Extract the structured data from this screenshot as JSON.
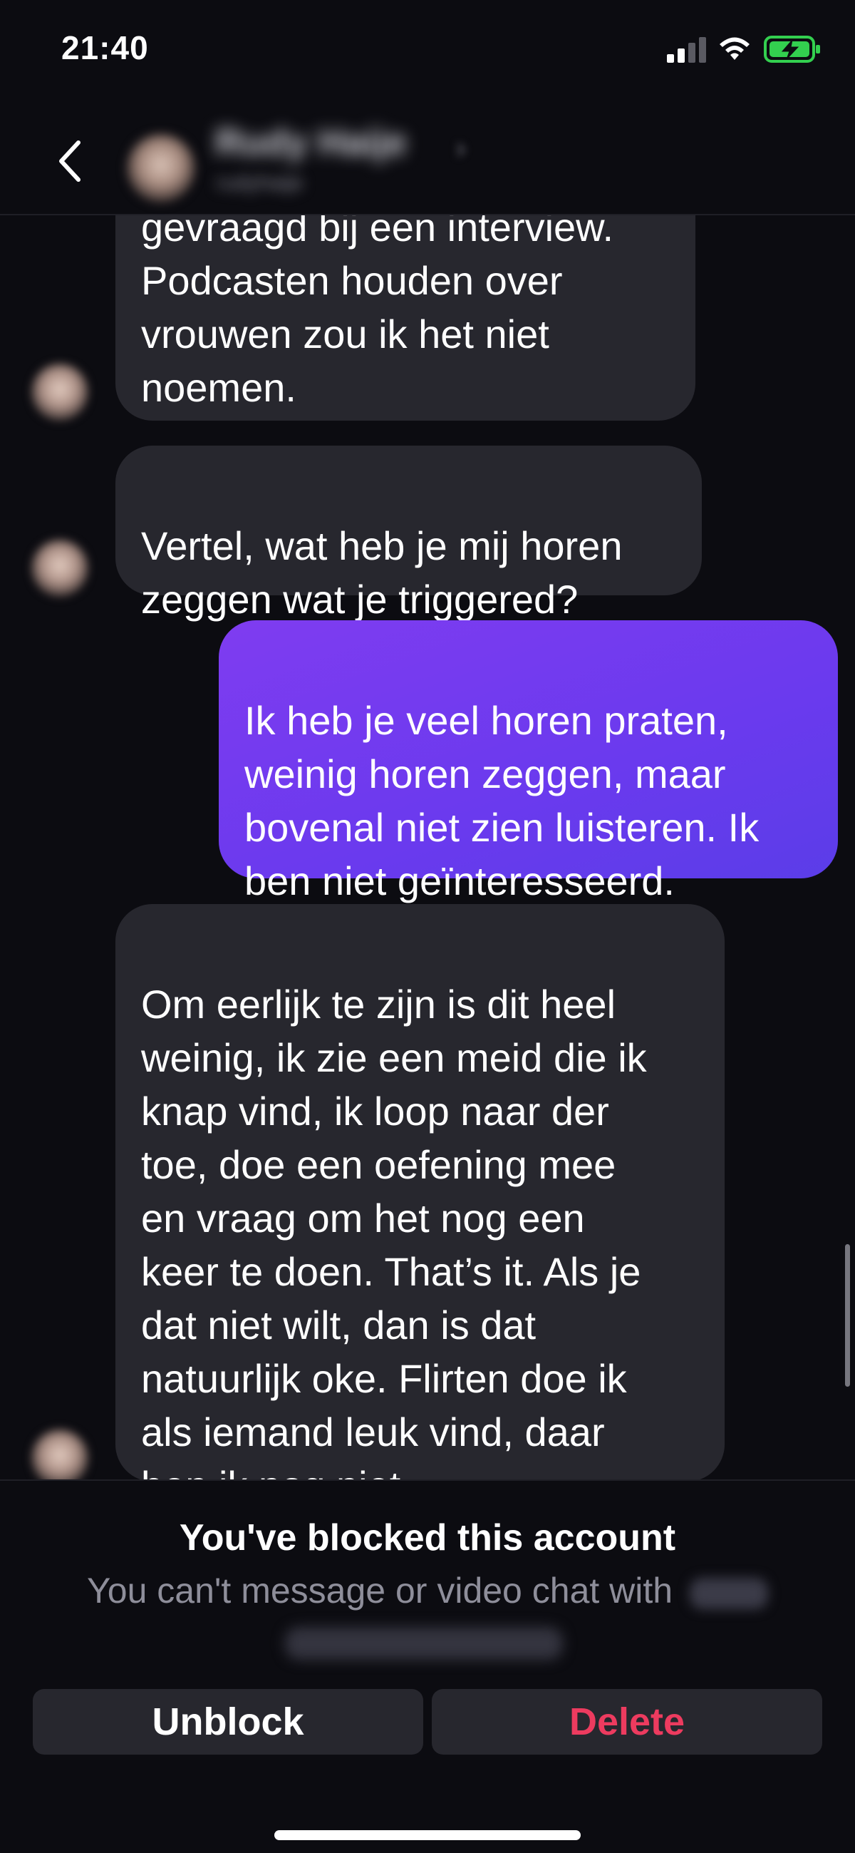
{
  "status_bar": {
    "time": "21:40",
    "icons": [
      "cellular-signal-icon",
      "wifi-icon",
      "battery-charging-icon"
    ],
    "battery_color": "#33d04f"
  },
  "header": {
    "back_icon": "chevron-left-icon",
    "contact_name": "Rudy Haije",
    "contact_sub": "rudyhaije"
  },
  "messages": [
    {
      "direction": "incoming",
      "text": "gevraagd bij een interview.\nPodcasten houden over\nvrouwen zou ik het niet\nnoemen."
    },
    {
      "direction": "incoming",
      "text": "Vertel, wat heb je mij horen\nzeggen wat je triggered?"
    },
    {
      "direction": "outgoing",
      "text": "Ik heb je veel horen praten,\nweinig horen zeggen, maar\nbovenal niet zien luisteren. Ik\nben niet geïnteresseerd."
    },
    {
      "direction": "incoming",
      "text": "Om eerlijk te zijn is dit heel\nweinig, ik zie een meid die ik\nknap vind, ik loop naar der\ntoe, doe een oefening mee\nen vraag om het nog een\nkeer te doen. That’s it. Als je\ndat niet wilt, dan is dat\nnatuurlijk oke. Flirten doe ik\nals iemand leuk vind, daar\nben ik nog niet."
    }
  ],
  "colors": {
    "background": "#0c0c11",
    "incoming_bubble": "#27272e",
    "outgoing_bubble": "#7040ee",
    "delete_text": "#ed3b5f"
  },
  "footer": {
    "title": "You've blocked this account",
    "text": "You can't message or video chat with",
    "unblock_label": "Unblock",
    "delete_label": "Delete"
  }
}
